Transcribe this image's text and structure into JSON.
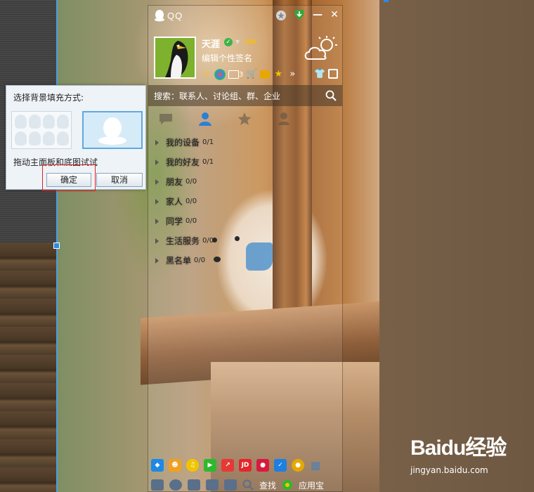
{
  "window": {
    "title": "QQ"
  },
  "profile": {
    "nickname": "天涯",
    "level_badge": "LV0",
    "signature": "编辑个性签名",
    "mail_count": "3"
  },
  "search": {
    "placeholder": "搜索：联系人、讨论组、群、企业"
  },
  "groups": [
    {
      "name": "我的设备",
      "count": "0/1"
    },
    {
      "name": "我的好友",
      "count": "0/1"
    },
    {
      "name": "朋友",
      "count": "0/0"
    },
    {
      "name": "家人",
      "count": "0/0"
    },
    {
      "name": "同学",
      "count": "0/0"
    },
    {
      "name": "生活服务",
      "count": "0/0"
    },
    {
      "name": "黑名单",
      "count": "0/0"
    }
  ],
  "bottom_bar": {
    "app_icons": [
      "tencent-box-icon",
      "game-icon",
      "music-icon",
      "video-icon",
      "stock-icon",
      "jd-icon",
      "lottery-icon",
      "security-icon",
      "pet-icon",
      "grid-icon"
    ],
    "jd_label": "JD",
    "find_label": "查找",
    "appstore_label": "应用宝"
  },
  "dialog": {
    "title": "选择背景填充方式:",
    "hint": "拖动主面板和底图试试",
    "ok_label": "确定",
    "cancel_label": "取消"
  },
  "watermark": {
    "brand": "Baidu经验",
    "url": "jingyan.baidu.com"
  },
  "colors": {
    "accent": "#5fa8e0",
    "highlight": "#e0201f",
    "online_green": "#3cb34a"
  }
}
